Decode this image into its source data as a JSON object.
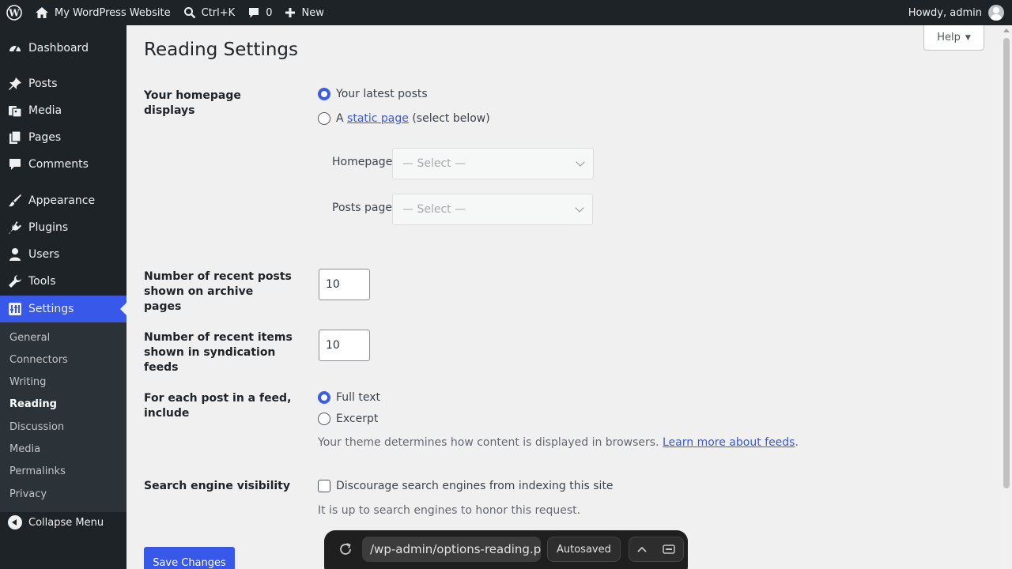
{
  "adminbar": {
    "site_name": "My WordPress Website",
    "search_shortcut": "Ctrl+K",
    "comments_count": "0",
    "new_label": "New",
    "greeting": "Howdy, admin"
  },
  "sidebar": {
    "items": [
      {
        "label": "Dashboard",
        "icon": "dashboard-icon"
      },
      {
        "label": "Posts",
        "icon": "pin-icon"
      },
      {
        "label": "Media",
        "icon": "media-icon"
      },
      {
        "label": "Pages",
        "icon": "pages-icon"
      },
      {
        "label": "Comments",
        "icon": "comment-icon"
      },
      {
        "label": "Appearance",
        "icon": "brush-icon"
      },
      {
        "label": "Plugins",
        "icon": "plugin-icon"
      },
      {
        "label": "Users",
        "icon": "user-icon"
      },
      {
        "label": "Tools",
        "icon": "wrench-icon"
      },
      {
        "label": "Settings",
        "icon": "settings-icon"
      }
    ],
    "submenu": [
      "General",
      "Connectors",
      "Writing",
      "Reading",
      "Discussion",
      "Media",
      "Permalinks",
      "Privacy"
    ],
    "current_submenu": "Reading",
    "collapse_label": "Collapse Menu"
  },
  "main": {
    "help_label": "Help",
    "title": "Reading Settings",
    "homepage_displays": {
      "label": "Your homepage displays",
      "option_latest": "Your latest posts",
      "option_static_prefix": "A",
      "option_static_link": "static page",
      "option_static_suffix": "(select below)",
      "homepage_label": "Homepage:",
      "posts_page_label": "Posts page:",
      "select_placeholder": "— Select —"
    },
    "recent_posts": {
      "label": "Number of recent posts shown on archive pages",
      "value": "10"
    },
    "syndication": {
      "label": "Number of recent items shown in syndication feeds",
      "value": "10"
    },
    "feed_include": {
      "label": "For each post in a feed, include",
      "option_full": "Full text",
      "option_excerpt": "Excerpt",
      "desc_text": "Your theme determines how content is displayed in browsers.",
      "desc_link": "Learn more about feeds",
      "desc_end": "."
    },
    "search_visibility": {
      "label": "Search engine visibility",
      "checkbox_label": "Discourage search engines from indexing this site",
      "desc": "It is up to search engines to honor this request."
    },
    "save_label": "Save Changes"
  },
  "overlay": {
    "url": "/wp-admin/options-reading.ph",
    "status": "Autosaved"
  },
  "colors": {
    "accent": "#3858e9",
    "sidebar_bg": "#1d2327",
    "page_bg": "#f0f0f1"
  }
}
